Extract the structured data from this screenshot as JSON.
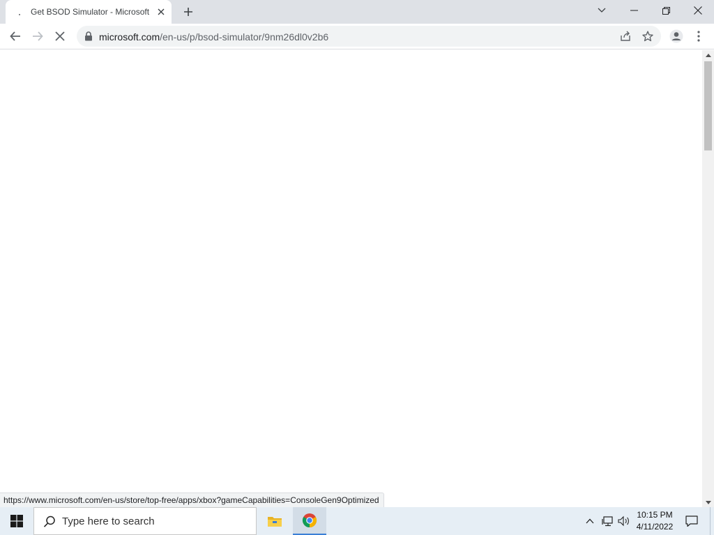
{
  "browser": {
    "tab": {
      "title": "Get BSOD Simulator - Microsoft Store",
      "close_label": "×"
    },
    "new_tab_label": "+",
    "window_controls": [
      "minimize",
      "restore",
      "close"
    ],
    "address": {
      "host": "microsoft.com",
      "path": "/en-us/p/bsod-simulator/9nm26dl0v2b6"
    },
    "status_url": "https://www.microsoft.com/en-us/store/top-free/apps/xbox?gameCapabilities=ConsoleGen9Optimized",
    "icons": {
      "back": "arrow-left-icon",
      "forward": "arrow-right-icon",
      "stop": "loading-spinner-icon",
      "lock": "lock-icon",
      "share": "share-icon",
      "bookmark": "star-icon",
      "profile": "person-icon",
      "menu": "kebab-menu-icon"
    }
  },
  "taskbar": {
    "search_placeholder": "Type here to search",
    "time": "10:15 PM",
    "date": "4/11/2022",
    "apps": [
      "file-explorer",
      "chrome"
    ],
    "accent": "#3a7fd6"
  }
}
